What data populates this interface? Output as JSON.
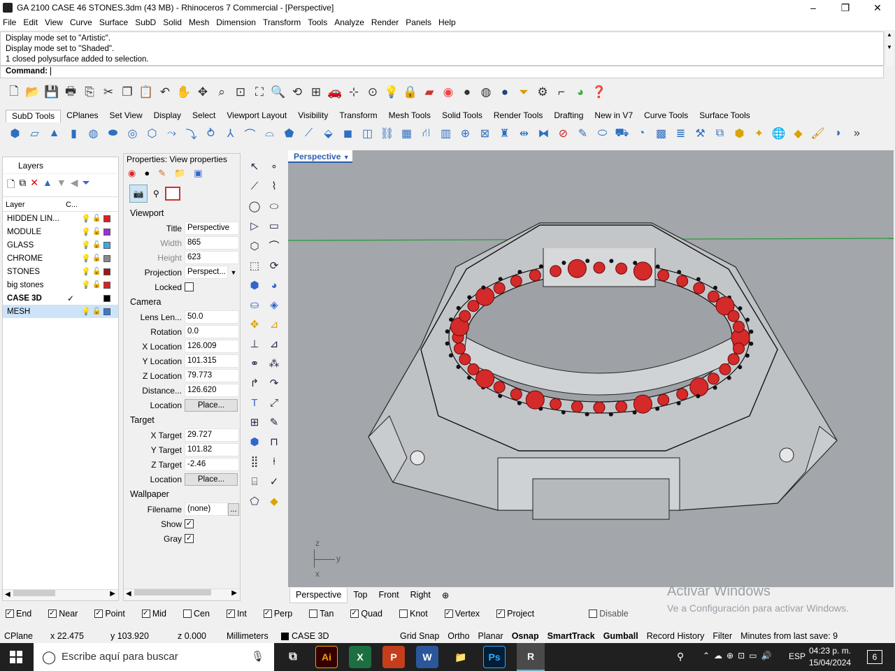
{
  "window": {
    "title": "GA 2100 CASE 46 STONES.3dm (43 MB) - Rhinoceros 7 Commercial - [Perspective]",
    "minimize": "–",
    "maximize": "❐",
    "close": "✕"
  },
  "menu": [
    "File",
    "Edit",
    "View",
    "Curve",
    "Surface",
    "SubD",
    "Solid",
    "Mesh",
    "Dimension",
    "Transform",
    "Tools",
    "Analyze",
    "Render",
    "Panels",
    "Help"
  ],
  "history": [
    "Display mode set to \"Artistic\".",
    "Display mode set to \"Shaded\".",
    "1 closed polysurface added to selection."
  ],
  "command_label": "Command:",
  "toolbar_tabs": [
    "SubD Tools",
    "CPlanes",
    "Set View",
    "Display",
    "Select",
    "Viewport Layout",
    "Visibility",
    "Transform",
    "Mesh Tools",
    "Solid Tools",
    "Render Tools",
    "Drafting",
    "New in V7",
    "Curve Tools",
    "Surface Tools"
  ],
  "layers": {
    "panel_title": "Layers",
    "col_layer": "Layer",
    "col_c": "C...",
    "rows": [
      {
        "name": "HIDDEN LIN...",
        "color": "#e02020",
        "bold": false,
        "current": false,
        "selected": false
      },
      {
        "name": "MODULE",
        "color": "#9b30d9",
        "bold": false,
        "current": false,
        "selected": false
      },
      {
        "name": "GLASS",
        "color": "#3fa9e6",
        "bold": false,
        "current": false,
        "selected": false
      },
      {
        "name": "CHROME",
        "color": "#8a8a8a",
        "bold": false,
        "current": false,
        "selected": false
      },
      {
        "name": "STONES",
        "color": "#a01818",
        "bold": false,
        "current": false,
        "selected": false
      },
      {
        "name": "big stones",
        "color": "#e02020",
        "bold": false,
        "current": false,
        "selected": false
      },
      {
        "name": "CASE 3D",
        "color": "#000000",
        "bold": true,
        "current": true,
        "selected": false
      },
      {
        "name": "MESH",
        "color": "#3a7ad6",
        "bold": false,
        "current": false,
        "selected": true
      }
    ]
  },
  "properties": {
    "title": "Properties: View properties",
    "viewport_label": "Viewport",
    "title_label": "Title",
    "title_value": "Perspective",
    "width_label": "Width",
    "width_value": "865",
    "height_label": "Height",
    "height_value": "623",
    "projection_label": "Projection",
    "projection_value": "Perspect...",
    "locked_label": "Locked",
    "camera_label": "Camera",
    "lens_label": "Lens Len...",
    "lens_value": "50.0",
    "rotation_label": "Rotation",
    "rotation_value": "0.0",
    "xloc_label": "X Location",
    "xloc_value": "126.009",
    "yloc_label": "Y Location",
    "yloc_value": "101.315",
    "zloc_label": "Z Location",
    "zloc_value": "79.773",
    "dist_label": "Distance...",
    "dist_value": "126.620",
    "location_label": "Location",
    "place_button": "Place...",
    "target_label": "Target",
    "xt_label": "X Target",
    "xt_value": "29.727",
    "yt_label": "Y Target",
    "yt_value": "101.82",
    "zt_label": "Z Target",
    "zt_value": "-2.46",
    "wallpaper_label": "Wallpaper",
    "filename_label": "Filename",
    "filename_value": "(none)",
    "browse": "...",
    "show_label": "Show",
    "gray_label": "Gray"
  },
  "viewport": {
    "title": "Perspective",
    "axis_z": "z",
    "axis_y": "y",
    "axis_x": "x"
  },
  "viewport_tabs": [
    "Perspective",
    "Top",
    "Front",
    "Right",
    "⊕"
  ],
  "watermark": {
    "line1": "Activar Windows",
    "line2": "Ve a Configuración para activar Windows."
  },
  "osnap": [
    {
      "label": "End",
      "on": true
    },
    {
      "label": "Near",
      "on": true
    },
    {
      "label": "Point",
      "on": true
    },
    {
      "label": "Mid",
      "on": true
    },
    {
      "label": "Cen",
      "on": false
    },
    {
      "label": "Int",
      "on": true
    },
    {
      "label": "Perp",
      "on": true
    },
    {
      "label": "Tan",
      "on": false
    },
    {
      "label": "Quad",
      "on": true
    },
    {
      "label": "Knot",
      "on": false
    },
    {
      "label": "Vertex",
      "on": true
    },
    {
      "label": "Project",
      "on": true
    },
    {
      "label": "Disable",
      "on": false
    }
  ],
  "status": {
    "cplane": "CPlane",
    "x": "x 22.475",
    "y": "y 103.920",
    "z": "z 0.000",
    "units": "Millimeters",
    "layer": "CASE 3D",
    "grid_snap": "Grid Snap",
    "ortho": "Ortho",
    "planar": "Planar",
    "osnap": "Osnap",
    "smarttrack": "SmartTrack",
    "gumball": "Gumball",
    "record": "Record History",
    "filter": "Filter",
    "minutes": "Minutes from last save: 9"
  },
  "taskbar": {
    "search": "Escribe aquí para buscar",
    "lang": "ESP",
    "time": "04:23 p. m.",
    "date": "15/04/2024",
    "notif": "6",
    "apps": [
      "Ai",
      "X",
      "P",
      "W",
      "📁",
      "Ps",
      "R"
    ]
  }
}
